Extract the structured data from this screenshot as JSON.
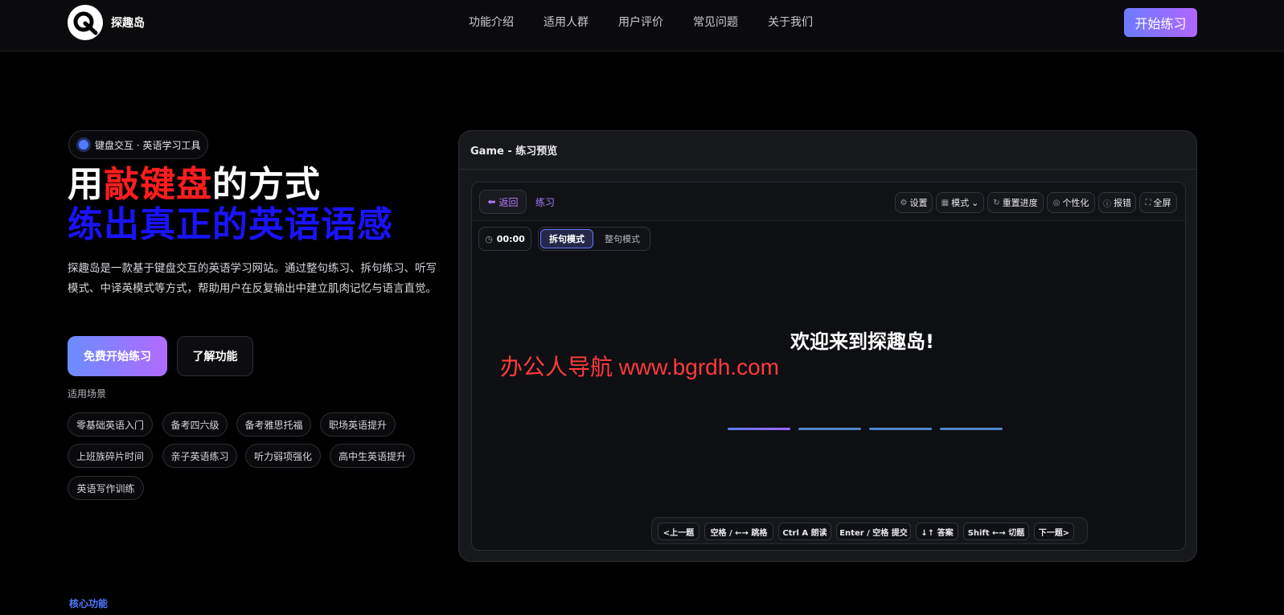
{
  "brand": {
    "name": "探趣岛"
  },
  "nav": {
    "items": [
      "功能介绍",
      "适用人群",
      "用户评价",
      "常见问题",
      "关于我们"
    ],
    "cta": "开始练习"
  },
  "hero": {
    "badge": "键盘交互 · 英语学习工具",
    "title_part1": "用",
    "title_highlight": "敲键盘",
    "title_part2": "的方式",
    "title_line2": "练出真正的英语语感",
    "description": "探趣岛是一款基于键盘交互的英语学习网站。通过整句练习、拆句练习、听写模式、中译英模式等方式，帮助用户在反复输出中建立肌肉记忆与语言直觉。",
    "primary_button": "免费开始练习",
    "secondary_button": "了解功能",
    "scenarios_label": "适用场景",
    "scenarios": [
      "零基础英语入门",
      "备考四六级",
      "备考雅思托福",
      "职场英语提升",
      "上班族碎片时间",
      "亲子英语练习",
      "听力弱项强化",
      "高中生英语提升",
      "英语写作训练"
    ]
  },
  "core_label": "核心功能",
  "preview": {
    "title": "Game - 练习预览",
    "back": "返回",
    "crumb": "练习",
    "tools": {
      "settings": "设置",
      "mode": "模式",
      "reset": "重置进度",
      "personalize": "个性化",
      "report": "报错",
      "fullscreen": "全屏"
    },
    "timer": "00:00",
    "mode_split": "拆句模式",
    "mode_whole": "整句模式",
    "welcome": "欢迎来到探趣岛!",
    "watermark": "办公人导航 www.bgrdh.com",
    "shortcuts": [
      "<上一题",
      "空格 / ←→ 跳格",
      "Ctrl A 朗读",
      "Enter / 空格 提交",
      "↓↑ 答案",
      "Shift ←→ 切题",
      "下一题>"
    ]
  },
  "colors": {
    "accent_blue": "#4e7bff",
    "accent_purple": "#b066ff",
    "highlight_red": "#ff1d1d",
    "title_blue": "#1a13ff"
  }
}
